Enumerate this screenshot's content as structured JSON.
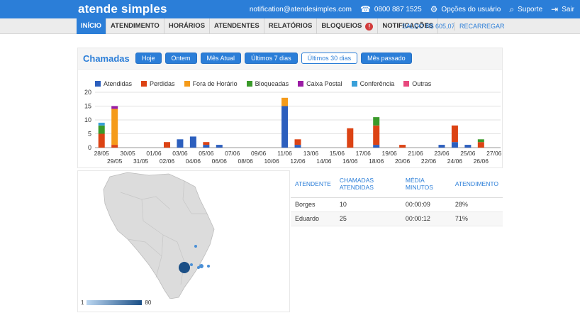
{
  "topbar": {
    "logo": "atende simples",
    "email": "notification@atendesimples.com",
    "phone": "0800 887 1525",
    "user_options": "Opções do usuário",
    "support": "Suporte",
    "logout": "Sair"
  },
  "nav": {
    "tabs": [
      "INÍCIO",
      "ATENDIMENTO",
      "HORÁRIOS",
      "ATENDENTES",
      "RELATÓRIOS",
      "BLOQUEIOS",
      "NOTIFICAÇÕES"
    ],
    "bloqueios_badge": "!",
    "saldo": "SALDO R$ 605,07",
    "recarregar": "RECARREGAR"
  },
  "chamadas": {
    "title": "Chamadas",
    "buttons": [
      "Hoje",
      "Ontem",
      "Mês Atual",
      "Últimos 7 dias",
      "Últimos 30 dias",
      "Mês passado"
    ],
    "selected_button": "Últimos 30 dias"
  },
  "chart_data": {
    "type": "bar",
    "stacked": true,
    "categories": [
      "28/05",
      "29/05",
      "30/05",
      "31/05",
      "01/06",
      "02/06",
      "03/06",
      "04/06",
      "05/06",
      "06/06",
      "07/06",
      "08/06",
      "09/06",
      "10/06",
      "11/06",
      "12/06",
      "13/06",
      "14/06",
      "15/06",
      "16/06",
      "17/06",
      "18/06",
      "19/06",
      "20/06",
      "21/06",
      "22/06",
      "23/06",
      "24/06",
      "25/06",
      "26/06",
      "27/06"
    ],
    "ylim": [
      0,
      20
    ],
    "yticks": [
      0,
      5,
      10,
      15,
      20
    ],
    "grid": true,
    "legend_position": "top",
    "series": [
      {
        "name": "Atendidas",
        "color": "#2c5fbe",
        "values": [
          0,
          0,
          0,
          0,
          0,
          0,
          3,
          4,
          1,
          1,
          0,
          0,
          0,
          0,
          15,
          1,
          0,
          0,
          0,
          0,
          0,
          1,
          0,
          0,
          0,
          0,
          1,
          2,
          1,
          0,
          0
        ]
      },
      {
        "name": "Perdidas",
        "color": "#dc4314",
        "values": [
          5,
          1,
          0,
          0,
          0,
          2,
          0,
          0,
          1,
          0,
          0,
          0,
          0,
          0,
          0,
          2,
          0,
          0,
          0,
          7,
          0,
          7,
          0,
          1,
          0,
          0,
          0,
          6,
          0,
          2,
          0
        ]
      },
      {
        "name": "Fora de Horário",
        "color": "#f59b1a",
        "values": [
          0,
          13,
          0,
          0,
          0,
          0,
          0,
          0,
          0,
          0,
          0,
          0,
          0,
          0,
          3,
          0,
          0,
          0,
          0,
          0,
          0,
          0,
          0,
          0,
          0,
          0,
          0,
          0,
          0,
          0,
          0
        ]
      },
      {
        "name": "Bloqueadas",
        "color": "#3a9a2a",
        "values": [
          3,
          0,
          0,
          0,
          0,
          0,
          0,
          0,
          0,
          0,
          0,
          0,
          0,
          0,
          0,
          0,
          0,
          0,
          0,
          0,
          0,
          3,
          0,
          0,
          0,
          0,
          0,
          0,
          0,
          1,
          0
        ]
      },
      {
        "name": "Caixa Postal",
        "color": "#9b1ca5",
        "values": [
          0,
          1,
          0,
          0,
          0,
          0,
          0,
          0,
          0,
          0,
          0,
          0,
          0,
          0,
          0,
          0,
          0,
          0,
          0,
          0,
          0,
          0,
          0,
          0,
          0,
          0,
          0,
          0,
          0,
          0,
          0
        ]
      },
      {
        "name": "Conferência",
        "color": "#3aa0d9",
        "values": [
          1,
          0,
          0,
          0,
          0,
          0,
          0,
          0,
          0,
          0,
          0,
          0,
          0,
          0,
          0,
          0,
          0,
          0,
          0,
          0,
          0,
          0,
          0,
          0,
          0,
          0,
          0,
          0,
          0,
          0,
          0
        ]
      },
      {
        "name": "Outras",
        "color": "#e8497e",
        "values": [
          0,
          0,
          0,
          0,
          0,
          0,
          0,
          0,
          0,
          0,
          0,
          0,
          0,
          0,
          0,
          0,
          0,
          0,
          0,
          0,
          0,
          0,
          0,
          0,
          0,
          0,
          0,
          0,
          0,
          0,
          0
        ]
      }
    ]
  },
  "map": {
    "scale_min": "1",
    "scale_max": "80",
    "color_low": "#bcd7f1",
    "color_high": "#1b4f86"
  },
  "attendants": {
    "headers": [
      "ATENDENTE",
      "CHAMADAS ATENDIDAS",
      "MÉDIA MINUTOS",
      "ATENDIMENTO"
    ],
    "rows": [
      [
        "Borges",
        "10",
        "00:00:09",
        "28%"
      ],
      [
        "Eduardo",
        "25",
        "00:00:12",
        "71%"
      ]
    ]
  }
}
